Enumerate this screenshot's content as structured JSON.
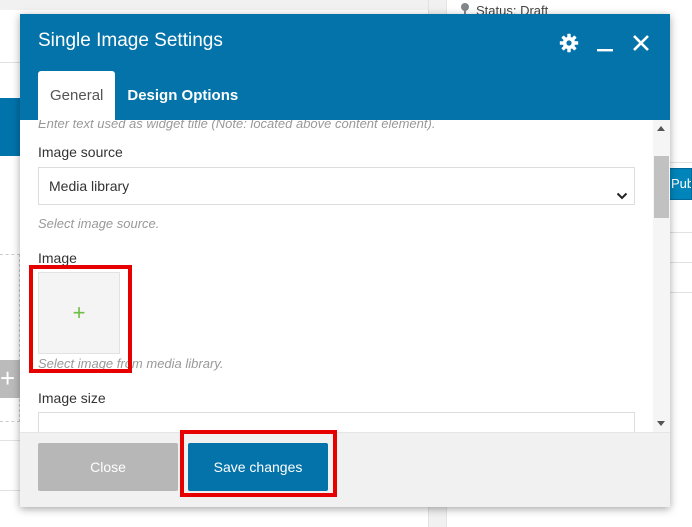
{
  "background": {
    "status_text": "Status: Draft",
    "publish_button_label": "Publish"
  },
  "modal": {
    "title": "Single Image Settings",
    "tabs": [
      {
        "label": "General",
        "active": true
      },
      {
        "label": "Design Options",
        "active": false
      }
    ],
    "header_icons": [
      "gear-icon",
      "minimize-icon",
      "close-icon"
    ],
    "faded_help_text": "Enter text used as widget title (Note: located above content element).",
    "image_source": {
      "label": "Image source",
      "value": "Media library",
      "help": "Select image source."
    },
    "image": {
      "label": "Image",
      "add_symbol": "+",
      "help": "Select image from media library."
    },
    "image_size": {
      "label": "Image size"
    },
    "footer": {
      "close_label": "Close",
      "save_label": "Save changes"
    }
  },
  "colors": {
    "header_blue": "#0473aa",
    "highlight_red": "#e60000",
    "plus_green": "#6ebd44"
  }
}
